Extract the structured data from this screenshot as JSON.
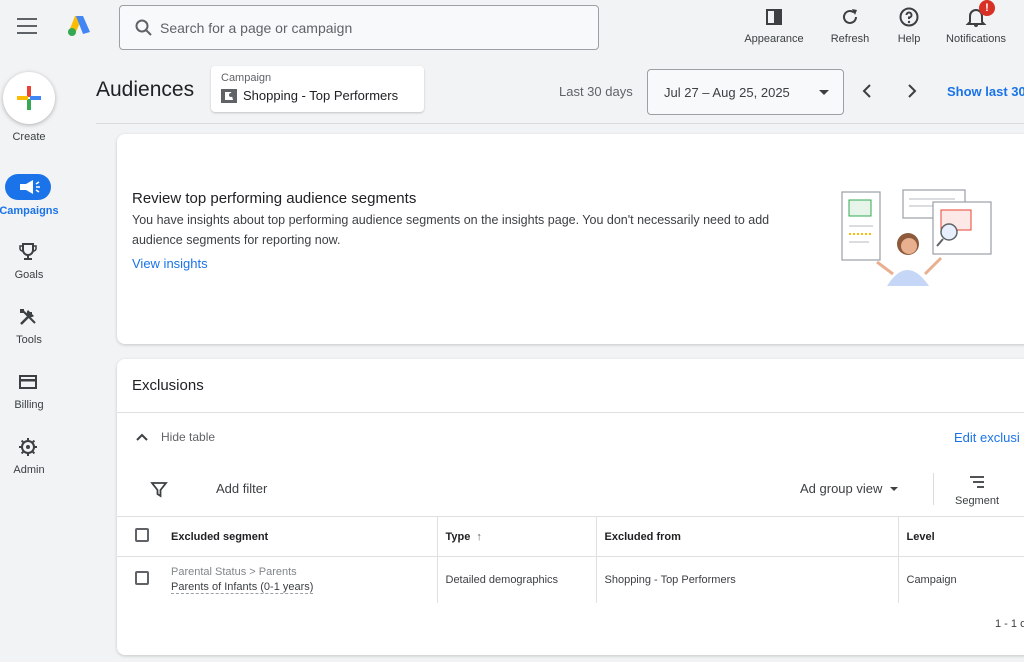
{
  "topbar": {
    "search_placeholder": "Search for a page or campaign",
    "buttons": [
      {
        "label": "Appearance",
        "icon": "appearance-icon"
      },
      {
        "label": "Refresh",
        "icon": "refresh-icon"
      },
      {
        "label": "Help",
        "icon": "help-icon"
      },
      {
        "label": "Notifications",
        "icon": "bell-icon",
        "badge": "!"
      }
    ]
  },
  "leftnav": {
    "create_label": "Create",
    "items": [
      {
        "label": "Campaigns",
        "icon": "megaphone-icon",
        "active": true
      },
      {
        "label": "Goals",
        "icon": "trophy-icon"
      },
      {
        "label": "Tools",
        "icon": "tools-icon"
      },
      {
        "label": "Billing",
        "icon": "credit-card-icon"
      },
      {
        "label": "Admin",
        "icon": "gear-icon"
      }
    ]
  },
  "header": {
    "title": "Audiences",
    "campaign_label": "Campaign",
    "campaign_value": "Shopping - Top Performers",
    "range_label": "Last 30 days",
    "date_range": "Jul 27 – Aug 25, 2025",
    "show_last": "Show last 30"
  },
  "insight": {
    "title": "Review top performing audience segments",
    "body": "You have insights about top performing audience segments on the insights page. You don't necessarily need to add audience segments for reporting now.",
    "link": "View insights"
  },
  "exclusions": {
    "title": "Exclusions",
    "hide_table": "Hide table",
    "edit_link": "Edit exclusi",
    "add_filter": "Add filter",
    "view_select": "Ad group view",
    "segment_label": "Segment",
    "columns": [
      "Excluded segment",
      "Type",
      "Excluded from",
      "Level"
    ],
    "rows": [
      {
        "segment_path": "Parental Status > Parents",
        "segment_name": "Parents of Infants (0-1 years)",
        "type": "Detailed demographics",
        "excluded_from": "Shopping - Top Performers",
        "level": "Campaign"
      }
    ],
    "pager": "1 - 1 o"
  },
  "colors": {
    "accent": "#1a73e8",
    "background": "#f1f3f4",
    "badge": "#d93025"
  }
}
